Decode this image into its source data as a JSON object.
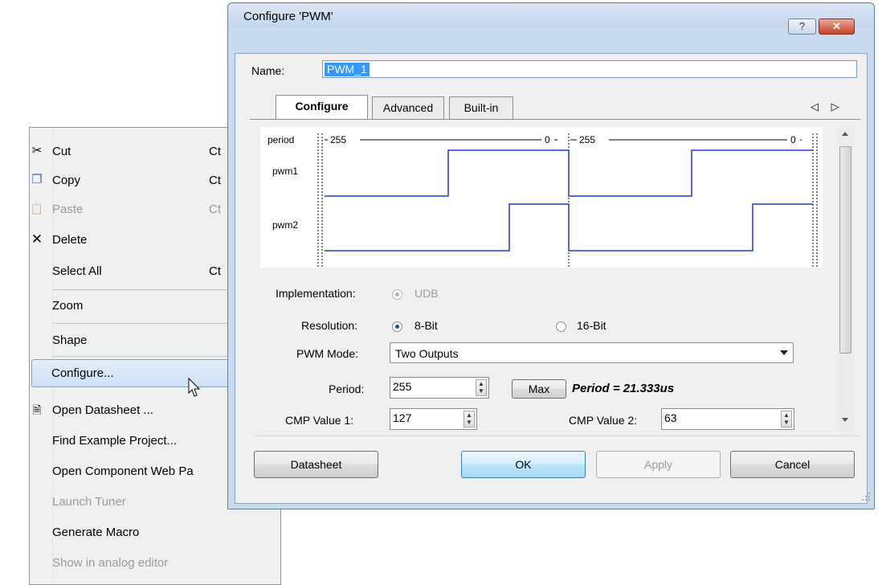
{
  "context_menu": {
    "items": [
      {
        "label": "Cut",
        "shortcut": "Ct",
        "icon": "scissors-icon",
        "glyph": "✂"
      },
      {
        "label": "Copy",
        "shortcut": "Ct",
        "icon": "copy-icon",
        "glyph": "❐"
      },
      {
        "label": "Paste",
        "shortcut": "Ct",
        "icon": "paste-icon",
        "glyph": "📋"
      },
      {
        "label": "Delete",
        "shortcut": "",
        "icon": "delete-icon",
        "glyph": "✕"
      },
      {
        "label": "Select All",
        "shortcut": "Ct"
      },
      {
        "label": "Zoom"
      },
      {
        "label": "Shape"
      },
      {
        "label": "Configure..."
      },
      {
        "label": "Open Datasheet ...",
        "icon": "datasheet-icon",
        "glyph": "🗎"
      },
      {
        "label": "Find Example Project..."
      },
      {
        "label": "Open Component Web Pa"
      },
      {
        "label": "Launch Tuner"
      },
      {
        "label": "Generate Macro"
      },
      {
        "label": "Show in analog editor"
      }
    ]
  },
  "dialog": {
    "title": "Configure 'PWM'",
    "help_label": "?",
    "close_label": "✕",
    "name_label": "Name:",
    "name_value": "PWM_1",
    "tabs": [
      "Configure",
      "Advanced",
      "Built-in"
    ],
    "tab_arrows": "◁ ▷",
    "waveform": {
      "period_label": "period",
      "pwm1_label": "pwm1",
      "pwm2_label": "pwm2",
      "period_start": "255",
      "period_end": "0"
    },
    "implementation_label": "Implementation:",
    "implementation_value": "UDB",
    "resolution_label": "Resolution:",
    "resolution_opt1": "8-Bit",
    "resolution_opt2": "16-Bit",
    "pwm_mode_label": "PWM Mode:",
    "pwm_mode_value": "Two Outputs",
    "period_label": "Period:",
    "period_value": "255",
    "max_label": "Max",
    "period_info": "Period = 21.333us",
    "cmp1_label": "CMP Value 1:",
    "cmp1_value": "127",
    "cmp2_label": "CMP Value 2:",
    "cmp2_value": "63",
    "buttons": {
      "datasheet": "Datasheet",
      "ok": "OK",
      "apply": "Apply",
      "cancel": "Cancel"
    }
  }
}
